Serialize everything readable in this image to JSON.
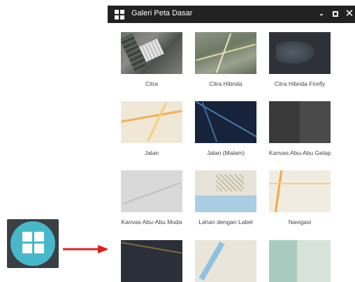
{
  "window": {
    "title": "Galeri Peta Dasar",
    "minimize_label": "-",
    "close_label": "✕"
  },
  "gallery": {
    "items": [
      {
        "label": "Citra",
        "icon": "imagery-thumbnail"
      },
      {
        "label": "Citra Hibrida",
        "icon": "imagery-hybrid-thumbnail"
      },
      {
        "label": "Citra Hibrida Firefly",
        "icon": "imagery-firefly-thumbnail"
      },
      {
        "label": "Jalan",
        "icon": "streets-thumbnail"
      },
      {
        "label": "Jalan (Malam)",
        "icon": "streets-night-thumbnail"
      },
      {
        "label": "Kanvas Abu-Abu Gelap",
        "icon": "dark-gray-canvas-thumbnail"
      },
      {
        "label": "Kanvas Abu-Abu Muda",
        "icon": "light-gray-canvas-thumbnail"
      },
      {
        "label": "Lahan dengan Label",
        "icon": "terrain-labels-thumbnail"
      },
      {
        "label": "Navigasi",
        "icon": "navigation-thumbnail"
      },
      {
        "label": "",
        "icon": "basemap-thumbnail"
      },
      {
        "label": "",
        "icon": "basemap-thumbnail"
      },
      {
        "label": "",
        "icon": "basemap-thumbnail"
      }
    ]
  },
  "colors": {
    "titlebar": "#222222",
    "launcher_accent": "#47b8c9",
    "arrow": "#e02020"
  }
}
